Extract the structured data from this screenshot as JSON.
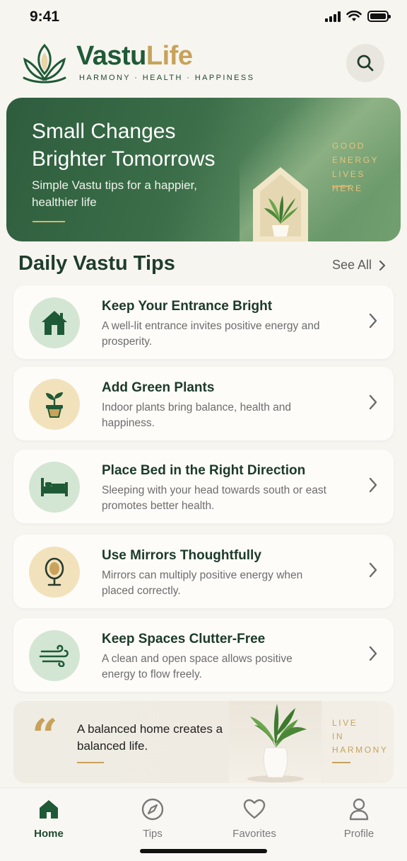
{
  "status_bar": {
    "time": "9:41"
  },
  "brand": {
    "name_part1": "Vastu",
    "name_part2": "Life",
    "tagline": "HARMONY · HEALTH · HAPPINESS"
  },
  "header": {
    "search_icon": "search-icon"
  },
  "hero": {
    "title_line1": "Small Changes",
    "title_line2": "Brighter Tomorrows",
    "subtitle": "Simple Vastu tips for a happier, healthier life",
    "side_line1": "GOOD",
    "side_line2": "ENERGY",
    "side_line3": "LIVES HERE"
  },
  "tips_section": {
    "title": "Daily Vastu Tips",
    "see_all": "See All"
  },
  "tips": [
    {
      "title": "Keep Your Entrance Bright",
      "description": "A well-lit entrance invites positive energy and prosperity.",
      "icon": "house-icon",
      "circle": "green"
    },
    {
      "title": "Add Green Plants",
      "description": "Indoor plants bring balance, health and happiness.",
      "icon": "plant-icon",
      "circle": "gold"
    },
    {
      "title": "Place Bed in the Right Direction",
      "description": "Sleeping with your head towards south or east promotes better health.",
      "icon": "bed-icon",
      "circle": "green"
    },
    {
      "title": "Use Mirrors Thoughtfully",
      "description": "Mirrors can multiply positive energy when placed correctly.",
      "icon": "mirror-icon",
      "circle": "gold"
    },
    {
      "title": "Keep Spaces Clutter-Free",
      "description": "A clean and open space allows positive energy to flow freely.",
      "icon": "wind-icon",
      "circle": "green"
    }
  ],
  "quote": {
    "mark": "“",
    "text": "A balanced home creates a balanced life.",
    "side_line1": "LIVE",
    "side_line2": "IN",
    "side_line3": "HARMONY"
  },
  "tab_bar": {
    "tabs": [
      {
        "label": "Home",
        "icon": "home-icon",
        "active": true
      },
      {
        "label": "Tips",
        "icon": "compass-icon",
        "active": false
      },
      {
        "label": "Favorites",
        "icon": "heart-icon",
        "active": false
      },
      {
        "label": "Profile",
        "icon": "user-icon",
        "active": false
      }
    ]
  },
  "colors": {
    "primary_green": "#1f5a36",
    "accent_gold": "#c7a25a",
    "background": "#f7f5f0"
  }
}
